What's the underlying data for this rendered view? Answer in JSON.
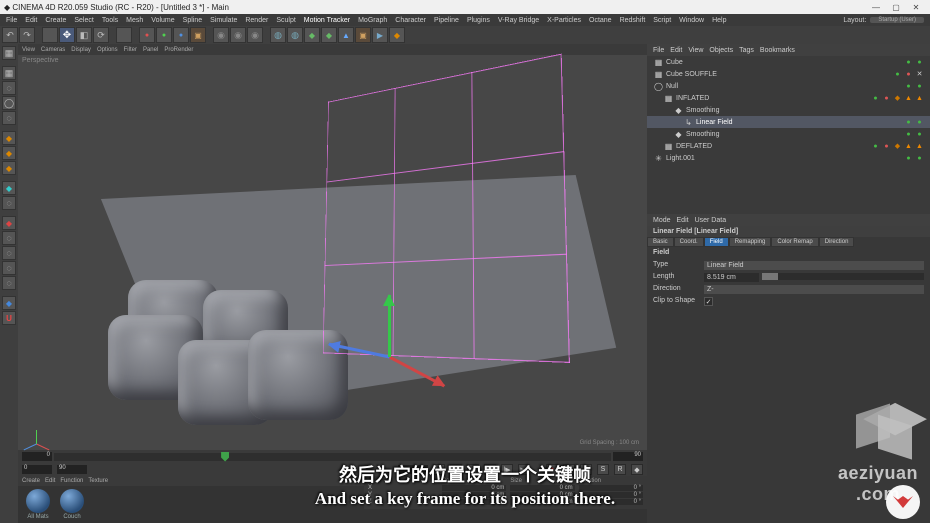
{
  "app": {
    "title": "CINEMA 4D R20.059 Studio (RC - R20) - [Untitled 3 *] - Main",
    "layout_hint": "Startup (User)"
  },
  "menu": [
    "File",
    "Edit",
    "Create",
    "Select",
    "Tools",
    "Mesh",
    "Volume",
    "Spline",
    "Simulate",
    "Render",
    "Sculpt",
    "Motion Tracker",
    "MoGraph",
    "Character",
    "Pipeline",
    "Plugins",
    "V-Ray Bridge",
    "X-Particles",
    "Octane",
    "Redshift",
    "Script",
    "Window",
    "Help"
  ],
  "viewport": {
    "tabs": [
      "View",
      "Cameras",
      "Display",
      "Options",
      "Filter",
      "Panel",
      "ProRender"
    ],
    "label": "Perspective",
    "grid_info": "Grid Spacing : 100 cm"
  },
  "timeline": {
    "start_frame": "0",
    "end_frame": "90",
    "current_frame": "0",
    "range_start": "0",
    "range_end": "90"
  },
  "transport": {
    "go_start": "|◀",
    "step_back": "◀|",
    "play_back": "◀",
    "play_fwd": "▶",
    "step_fwd": "|▶",
    "go_end": "▶|",
    "record": "●",
    "autokey": "◯",
    "key_pos": "P",
    "key_scl": "S",
    "key_rot": "R",
    "key_pla": "◆"
  },
  "materials": {
    "tabs": [
      "Create",
      "Edit",
      "Function",
      "Texture"
    ],
    "items": [
      {
        "name": "All Mats"
      },
      {
        "name": "Couch"
      }
    ]
  },
  "object_manager": {
    "tabs": [
      "File",
      "Edit",
      "View",
      "Objects",
      "Tags",
      "Bookmarks"
    ],
    "tree": [
      {
        "depth": 0,
        "icon": "▦",
        "name": "Cube",
        "tags": [
          "dot-g",
          "dot-g"
        ]
      },
      {
        "depth": 0,
        "icon": "▦",
        "name": "Cube SOUFFLE",
        "tags": [
          "dot-g",
          "dot-r",
          "tag-x"
        ]
      },
      {
        "depth": 0,
        "icon": "◯",
        "name": "Null",
        "tags": [
          "dot-g",
          "dot-g"
        ]
      },
      {
        "depth": 1,
        "icon": "▦",
        "name": "INFLATED",
        "tags": [
          "dot-g",
          "dot-r",
          "diam",
          "tri-o",
          "tri-o"
        ]
      },
      {
        "depth": 2,
        "icon": "◆",
        "name": "Smoothing",
        "tags": []
      },
      {
        "depth": 3,
        "icon": "↳",
        "name": "Linear Field",
        "selected": true,
        "tags": [
          "dot-g",
          "dot-g"
        ]
      },
      {
        "depth": 2,
        "icon": "◆",
        "name": "Smoothing",
        "tags": [
          "dot-g",
          "dot-g"
        ]
      },
      {
        "depth": 1,
        "icon": "▦",
        "name": "DEFLATED",
        "tags": [
          "dot-g",
          "dot-r",
          "diam",
          "tri-o",
          "tri-o"
        ]
      },
      {
        "depth": 0,
        "icon": "✳",
        "name": "Light.001",
        "tags": [
          "dot-g",
          "dot-g"
        ]
      }
    ]
  },
  "coordinates": {
    "headers": [
      "",
      "Position",
      "Size",
      "Rotation"
    ],
    "rows": [
      [
        "X",
        "0 cm",
        "0 cm",
        "0 °"
      ],
      [
        "Y",
        "0 cm",
        "0 cm",
        "0 °"
      ],
      [
        "Z",
        "0 cm",
        "0 cm",
        "0 °"
      ]
    ]
  },
  "attributes": {
    "tabs": [
      "Mode",
      "Edit",
      "User Data"
    ],
    "title": "Linear Field [Linear Field]",
    "subtabs": [
      "Basic",
      "Coord.",
      "Field",
      "Remapping",
      "Color Remap",
      "Direction"
    ],
    "selected_subtab": "Field",
    "section": "Field",
    "type_label": "Type",
    "type_value": "Linear Field",
    "length_label": "Length",
    "length_value": "8.519 cm",
    "direction_label": "Direction",
    "direction_value": "Z-",
    "clip_label": "Clip to Shape",
    "clip_value": true
  },
  "subtitles": {
    "cn": "然后为它的位置设置一个关键帧",
    "en": "And set a key frame for its position there."
  },
  "watermark": {
    "text1": "aeziyuan",
    "text2": ".com"
  }
}
